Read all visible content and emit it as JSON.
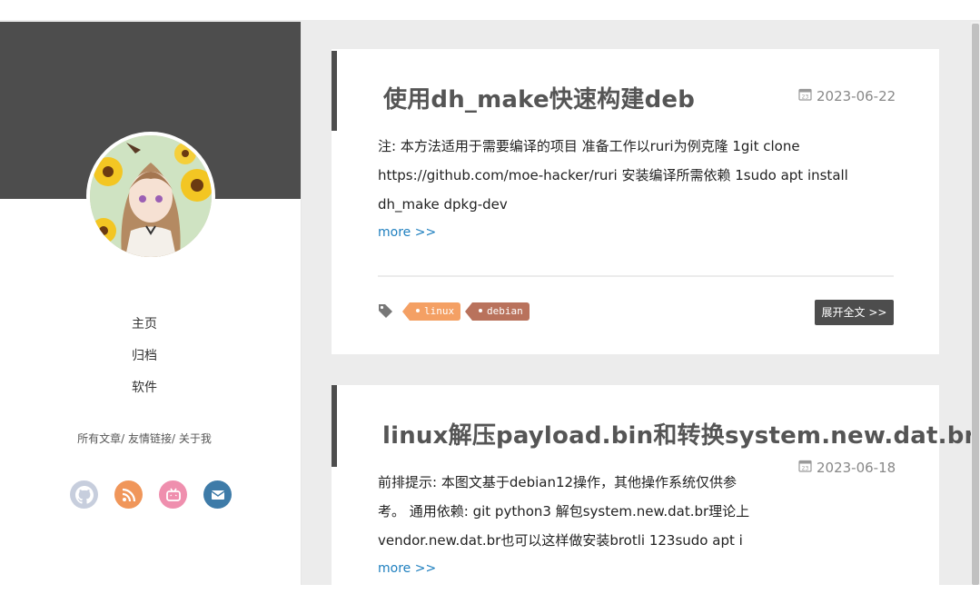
{
  "colors": {
    "sidebar_banner": "#4d4d4d",
    "content_bg": "#ececec",
    "link": "#1e7fbf",
    "tag_linux": "#f4a064",
    "tag_debian": "#b9725c",
    "github": "#c7cedd",
    "rss": "#f0965a",
    "bilibili": "#ef8fae",
    "email": "#3e7ba8"
  },
  "nav": {
    "items": [
      {
        "label": "主页"
      },
      {
        "label": "归档"
      },
      {
        "label": "软件"
      }
    ]
  },
  "sublinks": {
    "posts": "所有文章",
    "friends": "友情链接",
    "about": "关于我",
    "sep": "/ "
  },
  "social": [
    {
      "icon": "github-icon"
    },
    {
      "icon": "rss-icon"
    },
    {
      "icon": "bilibili-icon"
    },
    {
      "icon": "email-icon"
    }
  ],
  "posts": [
    {
      "title": "使用dh_make快速构建deb",
      "date": "2023-06-22",
      "excerpt_lines": [
        "注: 本方法适用于需要编译的项目 准备工作以ruri为例克隆 1git clone",
        "https://github.com/moe-hacker/ruri 安装编译所需依赖 1sudo apt install",
        "dh_make dpkg-dev"
      ],
      "more": "more >>",
      "tags": [
        "linux",
        "debian"
      ],
      "expand": "展开全文 >>"
    },
    {
      "title": "linux解压payload.bin和转换system.new.dat.br",
      "date": "2023-06-18",
      "excerpt_lines": [
        "前排提示: 本图文基于debian12操作，其他操作系统仅供参",
        "考。 通用依赖: git python3 解包system.new.dat.br理论上",
        "vendor.new.dat.br也可以这样做安装brotli 123sudo apt i"
      ],
      "more": "more >>"
    }
  ]
}
